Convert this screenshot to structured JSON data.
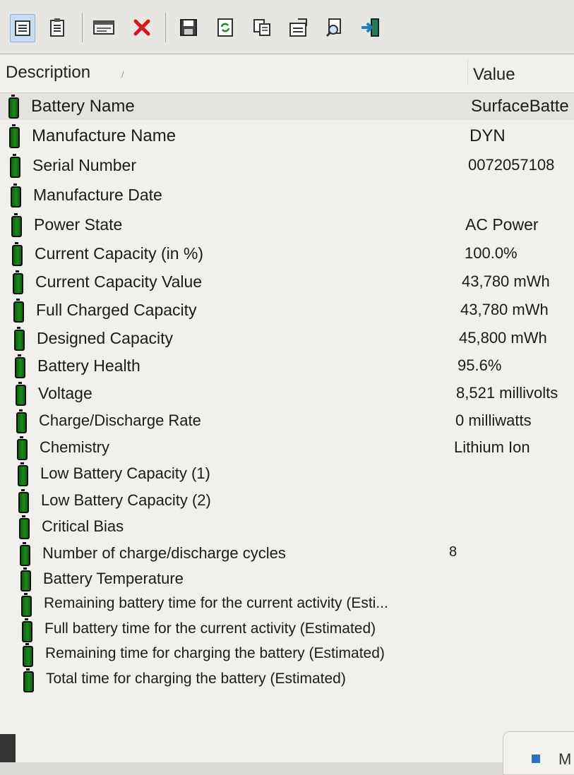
{
  "toolbar": {
    "buttons": [
      {
        "name": "html-report-all-items-icon"
      },
      {
        "name": "html-report-selected-items-icon"
      },
      {
        "name": "properties-icon"
      },
      {
        "name": "delete-icon"
      },
      {
        "name": "save-icon"
      },
      {
        "name": "refresh-icon"
      },
      {
        "name": "copy-icon"
      },
      {
        "name": "options-icon"
      },
      {
        "name": "find-icon"
      },
      {
        "name": "exit-icon"
      }
    ]
  },
  "columns": {
    "description": "Description",
    "value": "Value"
  },
  "rows": [
    {
      "label": "Battery Name",
      "value": "SurfaceBatte"
    },
    {
      "label": "Manufacture Name",
      "value": "DYN"
    },
    {
      "label": "Serial Number",
      "value": "0072057108"
    },
    {
      "label": "Manufacture Date",
      "value": ""
    },
    {
      "label": "Power State",
      "value": "AC Power"
    },
    {
      "label": "Current Capacity (in %)",
      "value": "100.0%"
    },
    {
      "label": "Current Capacity Value",
      "value": "43,780 mWh"
    },
    {
      "label": "Full Charged Capacity",
      "value": "43,780 mWh"
    },
    {
      "label": "Designed Capacity",
      "value": "45,800 mWh"
    },
    {
      "label": "Battery Health",
      "value": "95.6%"
    },
    {
      "label": "Voltage",
      "value": "8,521 millivolts"
    },
    {
      "label": "Charge/Discharge Rate",
      "value": "0 milliwatts"
    },
    {
      "label": "Chemistry",
      "value": "Lithium Ion"
    },
    {
      "label": "Low Battery Capacity (1)",
      "value": ""
    },
    {
      "label": "Low Battery Capacity (2)",
      "value": ""
    },
    {
      "label": "Critical Bias",
      "value": ""
    },
    {
      "label": "Number of charge/discharge cycles",
      "value": "8"
    },
    {
      "label": "Battery Temperature",
      "value": ""
    },
    {
      "label": "Remaining battery time for the current activity (Esti...",
      "value": ""
    },
    {
      "label": "Full battery time for the current activity (Estimated)",
      "value": ""
    },
    {
      "label": "Remaining time for charging the battery (Estimated)",
      "value": ""
    },
    {
      "label": "Total  time for charging the battery (Estimated)",
      "value": ""
    }
  ],
  "taskbar": {
    "partial_label": "M"
  },
  "colors": {
    "battery_icon": "#1d8a1d",
    "selection": "#c7dcf2",
    "delete_icon": "#d11a1a"
  }
}
